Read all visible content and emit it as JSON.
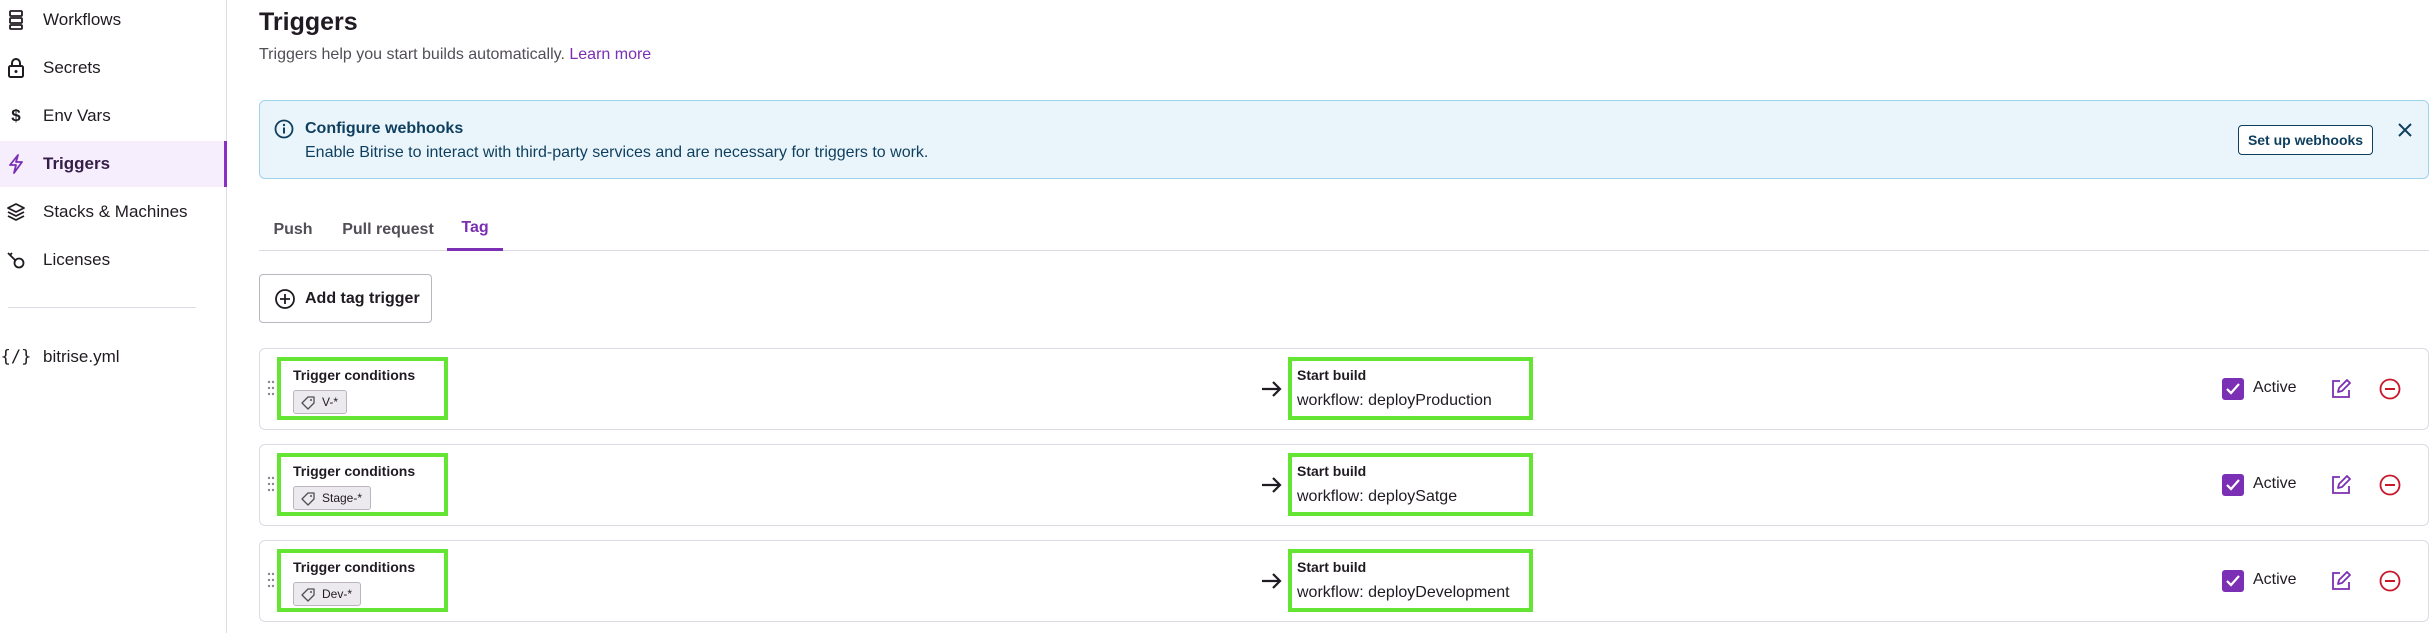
{
  "sidebar": {
    "items": [
      {
        "label": "Workflows",
        "icon": "workflows-icon"
      },
      {
        "label": "Secrets",
        "icon": "lock-icon"
      },
      {
        "label": "Env Vars",
        "icon": "dollar-icon"
      },
      {
        "label": "Triggers",
        "icon": "lightning-icon",
        "active": true
      },
      {
        "label": "Stacks & Machines",
        "icon": "layers-icon"
      },
      {
        "label": "Licenses",
        "icon": "license-key-icon"
      },
      {
        "label": "bitrise.yml",
        "icon": "code-braces-icon"
      }
    ]
  },
  "header": {
    "title": "Triggers",
    "description": "Triggers help you start builds automatically.",
    "learn_more": "Learn more"
  },
  "banner": {
    "title": "Configure webhooks",
    "text": "Enable Bitrise to interact with third-party services and are necessary for triggers to work.",
    "button": "Set up webhooks"
  },
  "tabs": [
    {
      "label": "Push"
    },
    {
      "label": "Pull request"
    },
    {
      "label": "Tag",
      "active": true
    }
  ],
  "add_button": "Add tag trigger",
  "triggers": [
    {
      "conditions_label": "Trigger conditions",
      "tag": "V-*",
      "build_label": "Start build",
      "workflow": "workflow: deployProduction",
      "active_label": "Active",
      "active": true
    },
    {
      "conditions_label": "Trigger conditions",
      "tag": "Stage-*",
      "build_label": "Start build",
      "workflow": "workflow: deploySatge",
      "active_label": "Active",
      "active": true
    },
    {
      "conditions_label": "Trigger conditions",
      "tag": "Dev-*",
      "build_label": "Start build",
      "workflow": "workflow: deployDevelopment",
      "active_label": "Active",
      "active": true
    }
  ],
  "colors": {
    "accent": "#7b2fb4",
    "highlight_box": "#64e534",
    "banner_bg": "#eaf5fb",
    "remove": "#c8162b"
  }
}
